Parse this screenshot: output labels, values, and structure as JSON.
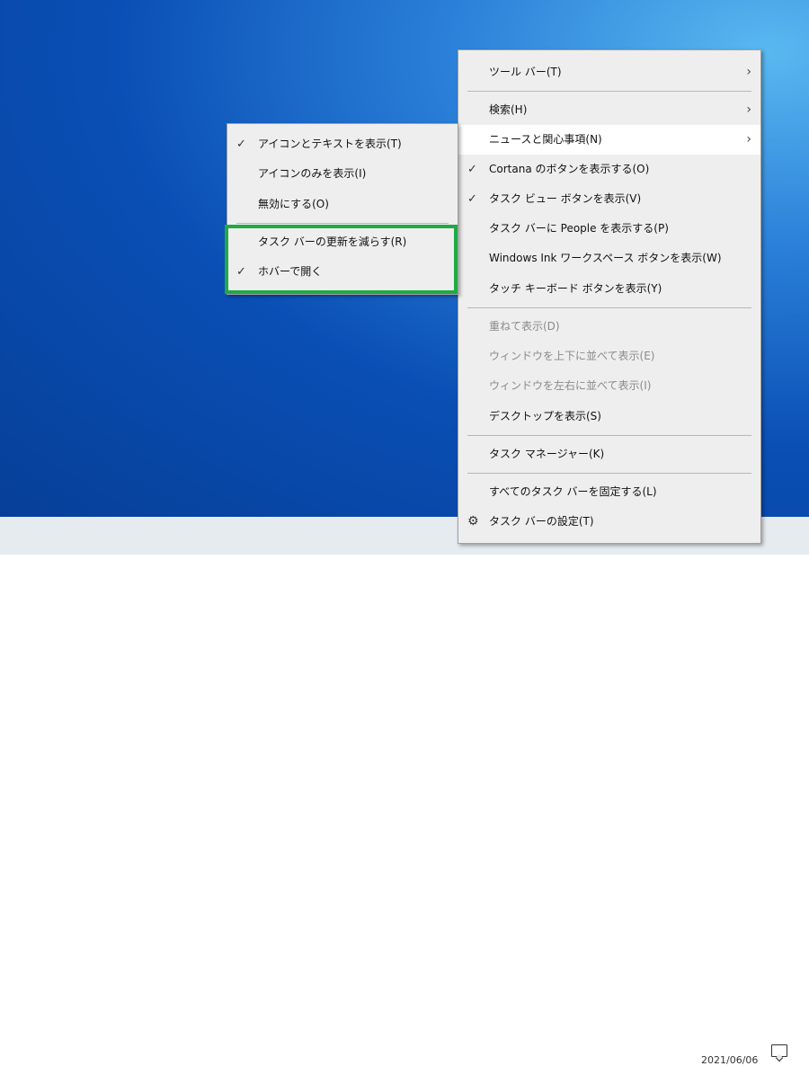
{
  "main_menu": {
    "items": [
      {
        "label": "ツール バー(T)",
        "submenu": true
      },
      {
        "label": "検索(H)",
        "submenu": true
      },
      {
        "label": "ニュースと関心事項(N)",
        "submenu": true,
        "highlighted": true
      },
      {
        "label": "Cortana のボタンを表示する(O)",
        "checked": true
      },
      {
        "label": "タスク ビュー ボタンを表示(V)",
        "checked": true
      },
      {
        "label": "タスク バーに People を表示する(P)"
      },
      {
        "label": "Windows Ink ワークスペース ボタンを表示(W)"
      },
      {
        "label": "タッチ キーボード ボタンを表示(Y)"
      },
      {
        "label": "重ねて表示(D)",
        "disabled": true
      },
      {
        "label": "ウィンドウを上下に並べて表示(E)",
        "disabled": true
      },
      {
        "label": "ウィンドウを左右に並べて表示(I)",
        "disabled": true
      },
      {
        "label": "デスクトップを表示(S)"
      },
      {
        "label": "タスク マネージャー(K)"
      },
      {
        "label": "すべてのタスク バーを固定する(L)"
      },
      {
        "label": "タスク バーの設定(T)",
        "icon": "gear-icon"
      }
    ]
  },
  "sub_menu": {
    "items": [
      {
        "label": "アイコンとテキストを表示(T)",
        "checked": true
      },
      {
        "label": "アイコンのみを表示(I)"
      },
      {
        "label": "無効にする(O)"
      },
      {
        "label": "タスク バーの更新を減らす(R)"
      },
      {
        "label": "ホバーで開く",
        "checked": true
      }
    ],
    "highlight_color": "#1faa45"
  },
  "glyphs": {
    "check": "✓",
    "arrow": "›",
    "gear": "⚙"
  },
  "taskbar": {
    "date": "2021/06/06"
  }
}
